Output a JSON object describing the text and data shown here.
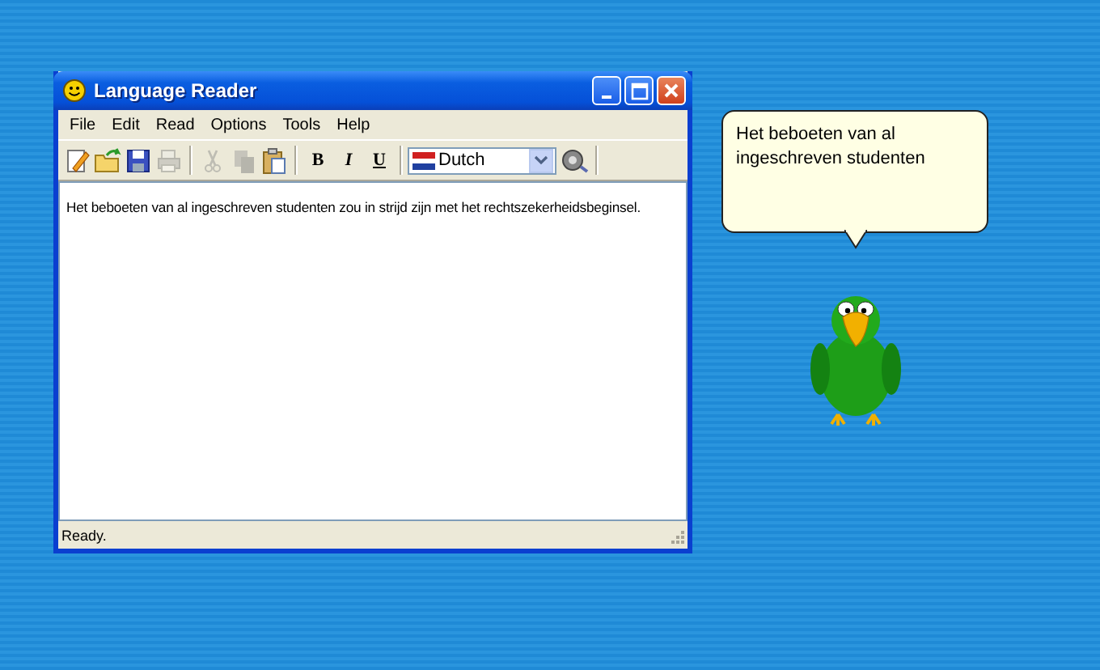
{
  "window": {
    "title": "Language Reader"
  },
  "menu": [
    "File",
    "Edit",
    "Read",
    "Options",
    "Tools",
    "Help"
  ],
  "toolbar": [
    {
      "kind": "new",
      "disabled": false
    },
    {
      "kind": "open",
      "disabled": false
    },
    {
      "kind": "save",
      "disabled": false
    },
    {
      "kind": "print",
      "disabled": true
    },
    {
      "kind": "separator"
    },
    {
      "kind": "cut",
      "disabled": true
    },
    {
      "kind": "copy",
      "disabled": true
    },
    {
      "kind": "paste",
      "disabled": false
    },
    {
      "kind": "separator"
    },
    {
      "kind": "text",
      "label": "B"
    },
    {
      "kind": "text",
      "label": "I"
    },
    {
      "kind": "text",
      "label": "U"
    },
    {
      "kind": "separator"
    },
    {
      "kind": "language",
      "value": "Dutch"
    },
    {
      "kind": "speak",
      "disabled": false
    },
    {
      "kind": "separator"
    }
  ],
  "editor": {
    "text": "Het beboeten van al ingeschreven studenten zou in strijd zijn met het rechtszekerheidsbeginsel."
  },
  "status_bar": "Ready.",
  "speech_bubble": {
    "text": "Het beboeten van al ingeschreven studenten"
  }
}
